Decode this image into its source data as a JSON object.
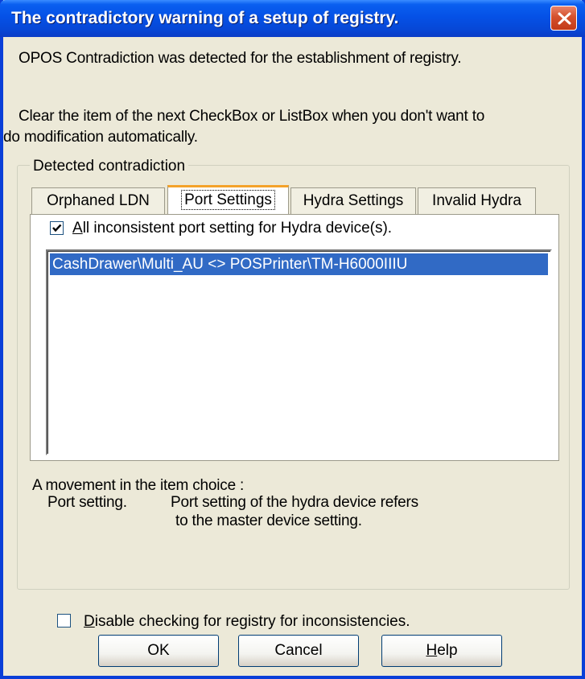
{
  "window": {
    "title": "The contradictory warning of a setup of registry."
  },
  "message": {
    "line1": "OPOS Contradiction was detected for the establishment of registry.",
    "line2": "Clear the item of the next CheckBox or ListBox when you don't want to",
    "line3": "do modification automatically."
  },
  "group": {
    "label": "Detected contradiction"
  },
  "tabs": [
    {
      "label": "Orphaned LDN",
      "active": false
    },
    {
      "label": "Port Settings",
      "active": true
    },
    {
      "label": "Hydra Settings",
      "active": false
    },
    {
      "label": "Invalid Hydra",
      "active": false
    }
  ],
  "panel": {
    "checkbox_label_mnemonic": "A",
    "checkbox_label_rest": "ll inconsistent port setting for Hydra device(s).",
    "checkbox_checked": true,
    "list_items": [
      {
        "text": "CashDrawer\\Multi_AU <> POSPrinter\\TM-H6000IIIU",
        "selected": true
      }
    ]
  },
  "movement": {
    "heading": "A movement in the item choice :",
    "item_name": "Port setting.",
    "desc_line1": "Port setting of the hydra device refers",
    "desc_line2": "to the master device setting."
  },
  "disable_check": {
    "label_mnemonic": "D",
    "label_rest": "isable checking for registry for inconsistencies.",
    "checked": false
  },
  "buttons": {
    "ok": "OK",
    "cancel": "Cancel",
    "help_mnemonic": "H",
    "help_rest": "elp"
  },
  "colors": {
    "titlebar": "#0551e6",
    "selection": "#316ac5",
    "close_button": "#d4502c",
    "active_tab_accent": "#f4a22a",
    "dialog_bg": "#ece9d8"
  }
}
